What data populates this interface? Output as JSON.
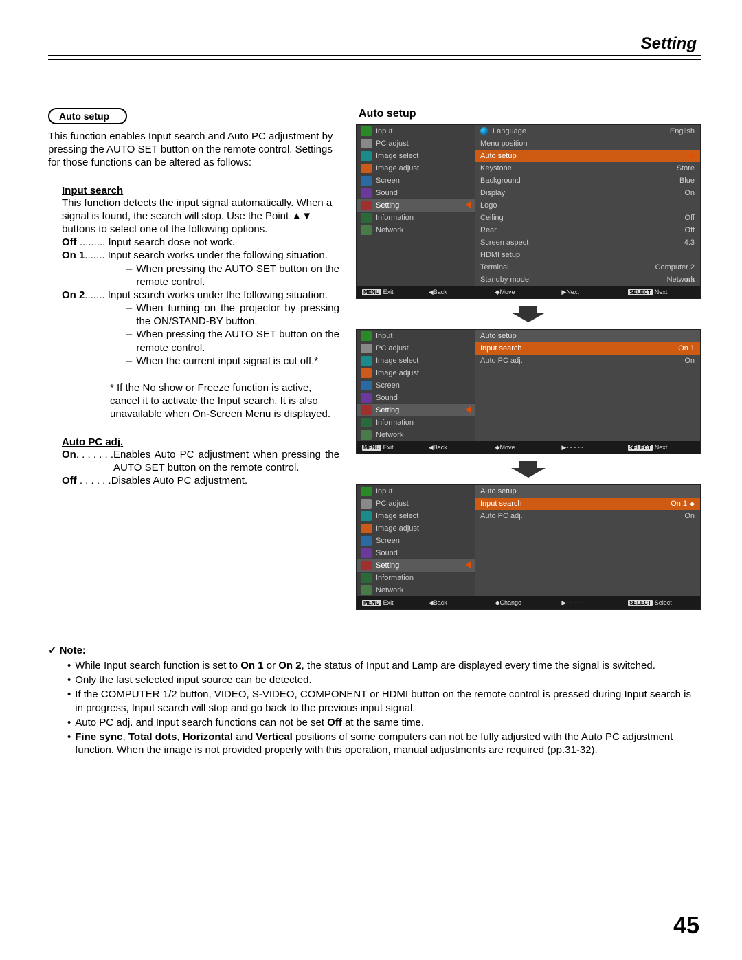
{
  "header": {
    "title": "Setting"
  },
  "page_number": "45",
  "left": {
    "pill": "Auto setup",
    "intro": "This function enables Input search and Auto PC adjustment by pressing the AUTO SET button on the remote control. Settings for those functions can be altered as follows:",
    "input_search": {
      "heading": "Input search",
      "desc": "This function detects the input signal automatically. When a signal is found, the search will stop. Use the Point ▲▼ buttons to select one of the following options.",
      "off_label": "Off",
      "off_dots": " ......... ",
      "off_desc": "Input search dose not work.",
      "on1_label": "On 1",
      "on1_dots": "....... ",
      "on1_desc": "Input search works under the following situation.",
      "on1_b1": "When pressing the AUTO SET button on the remote control.",
      "on2_label": "On 2",
      "on2_dots": "....... ",
      "on2_desc": "Input search works under the following situation.",
      "on2_b1": "When turning on the projector by pressing the ON/STAND-BY button.",
      "on2_b2": "When pressing the AUTO SET button on the remote control.",
      "on2_b3": "When the current input signal is cut off.*",
      "footnote": "* If the No show or Freeze function is active, cancel it to activate the Input search. It is also unavailable when On-Screen Menu is displayed."
    },
    "auto_pc": {
      "heading": "Auto PC adj.",
      "on_label": "On",
      "on_dots": ". . . . . . .",
      "on_desc": "Enables Auto PC adjustment when pressing the AUTO SET button on the remote control.",
      "off_label": "Off",
      "off_dots": " . . . . . .",
      "off_desc": "Disables Auto PC adjustment."
    }
  },
  "right": {
    "title": "Auto setup",
    "menu_left": [
      {
        "label": "Input",
        "icon": "ic-green"
      },
      {
        "label": "PC adjust",
        "icon": "ic-gray"
      },
      {
        "label": "Image select",
        "icon": "ic-teal"
      },
      {
        "label": "Image adjust",
        "icon": "ic-orange"
      },
      {
        "label": "Screen",
        "icon": "ic-blue"
      },
      {
        "label": "Sound",
        "icon": "ic-purple"
      },
      {
        "label": "Setting",
        "icon": "ic-red",
        "selected": true
      },
      {
        "label": "Information",
        "icon": "ic-info"
      },
      {
        "label": "Network",
        "icon": "ic-net"
      }
    ],
    "panel1": {
      "rows": [
        {
          "label": "Language",
          "val": "English",
          "globe": true
        },
        {
          "label": "Menu position",
          "val": ""
        },
        {
          "label": "Auto setup",
          "val": "",
          "selected": true,
          "arrow": true
        },
        {
          "label": "Keystone",
          "val": "Store"
        },
        {
          "label": "Background",
          "val": "Blue"
        },
        {
          "label": "Display",
          "val": "On"
        },
        {
          "label": "Logo",
          "val": ""
        },
        {
          "label": "Ceiling",
          "val": "Off"
        },
        {
          "label": "Rear",
          "val": "Off"
        },
        {
          "label": "Screen aspect",
          "val": "4:3"
        },
        {
          "label": "HDMI setup",
          "val": ""
        },
        {
          "label": "Terminal",
          "val": "Computer 2"
        },
        {
          "label": "Standby mode",
          "val": "Network"
        }
      ],
      "counter": "1/3",
      "foot": {
        "exit": "Exit",
        "back": "Back",
        "move": "Move",
        "next1": "Next",
        "next2": "Next"
      }
    },
    "panel2": {
      "title": "Auto setup",
      "rows": [
        {
          "label": "Input search",
          "val": "On 1",
          "selected": true
        },
        {
          "label": "Auto PC adj.",
          "val": "On"
        }
      ],
      "foot": {
        "exit": "Exit",
        "back": "Back",
        "move": "Move",
        "next1": "- - - - -",
        "next2": "Next"
      }
    },
    "panel3": {
      "title": "Auto setup",
      "rows": [
        {
          "label": "Input search",
          "val": "On 1",
          "selected": true,
          "spin": true
        },
        {
          "label": "Auto PC adj.",
          "val": "On"
        }
      ],
      "foot": {
        "exit": "Exit",
        "back": "Back",
        "move": "Change",
        "next1": "- - - - -",
        "next2": "Select"
      }
    }
  },
  "notes": {
    "heading": "Note:",
    "items": [
      {
        "pre": "While Input search function is set to ",
        "b1": "On 1",
        "mid": " or ",
        "b2": "On 2",
        "post": ", the status of Input and Lamp are displayed every time the signal is switched."
      },
      {
        "text": "Only the last selected input source can be detected."
      },
      {
        "text": "If the COMPUTER 1/2 button, VIDEO, S-VIDEO, COMPONENT or HDMI button on the remote control is pressed during Input search is in progress, Input search will stop and go back to the previous input signal."
      },
      {
        "pre": "Auto PC adj. and Input search functions can not be set ",
        "b1": "Off",
        "post": " at the same time."
      },
      {
        "b1": "Fine sync",
        "c1": ", ",
        "b2": "Total dots",
        "c2": ", ",
        "b3": "Horizontal",
        "c3": " and ",
        "b4": "Vertical",
        "post": " positions of some computers can not be fully adjusted with the Auto PC adjustment function. When the image is not provided properly with this operation, manual adjustments are required (pp.31-32)."
      }
    ]
  }
}
